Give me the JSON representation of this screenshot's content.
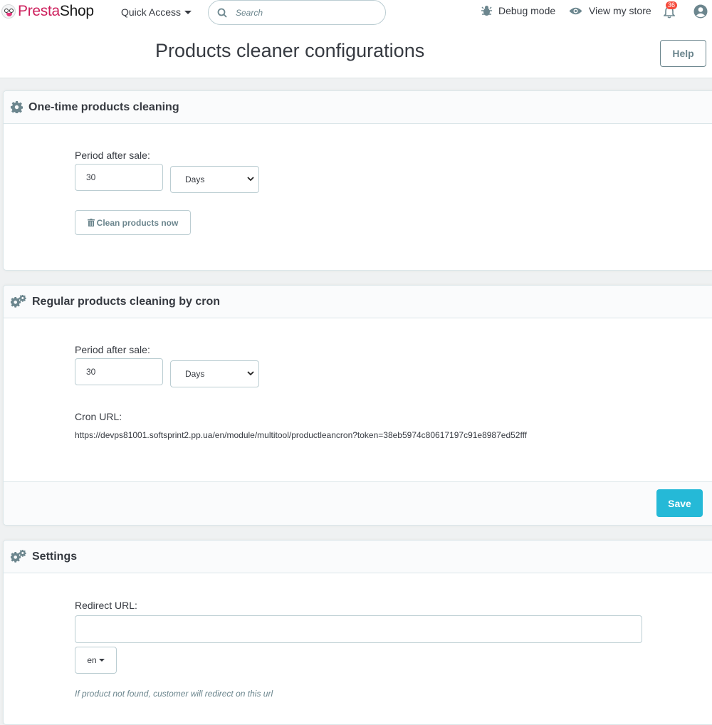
{
  "header": {
    "logo_part1": "Presta",
    "logo_part2": "Shop",
    "quick_access": "Quick Access",
    "search_placeholder": "Search",
    "debug_mode": "Debug mode",
    "view_store": "View my store",
    "notifications_count": "36"
  },
  "page": {
    "title": "Products cleaner configurations",
    "help_label": "Help"
  },
  "one_time": {
    "title": "One-time products cleaning",
    "period_label": "Period after sale:",
    "period_value": "30",
    "unit": "Days",
    "clean_button": "Clean products now"
  },
  "cron": {
    "title": "Regular products cleaning by cron",
    "period_label": "Period after sale:",
    "period_value": "30",
    "unit": "Days",
    "cron_url_label": "Cron URL:",
    "cron_url": "https://devps81001.softsprint2.pp.ua/en/module/multitool/productleancron?token=38eb5974c80617197c91e8987ed52fff",
    "save_label": "Save"
  },
  "settings": {
    "title": "Settings",
    "redirect_label": "Redirect URL:",
    "redirect_value": "",
    "lang": "en",
    "help_text": "If product not found, customer will redirect on this url"
  },
  "colors": {
    "brand": "#cd1f5c",
    "primary": "#25b9d7",
    "badge": "#f54c3e"
  }
}
